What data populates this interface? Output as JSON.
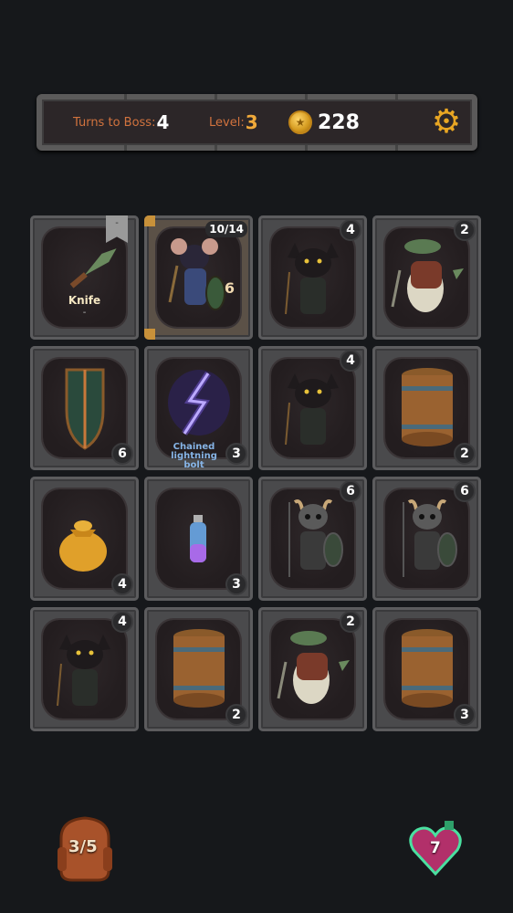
{
  "hud": {
    "turns_label": "Turns to Boss:",
    "turns_value": "4",
    "level_label": "Level:",
    "level_value": "3",
    "gold_value": "228",
    "settings_icon": "gear-icon"
  },
  "cards": [
    {
      "id": "knife",
      "kind": "weapon",
      "name": "Knife",
      "sub": "-",
      "ribbon": "-"
    },
    {
      "id": "hero",
      "kind": "hero",
      "hp": "10/14",
      "armor": "6"
    },
    {
      "id": "cat-rogue-1",
      "kind": "enemy",
      "value": "4"
    },
    {
      "id": "croc-1",
      "kind": "enemy",
      "value": "2"
    },
    {
      "id": "shield",
      "kind": "item",
      "value": "6"
    },
    {
      "id": "spell",
      "kind": "spell",
      "name": "Chained lightning bolt",
      "value": "3"
    },
    {
      "id": "cat-rogue-2",
      "kind": "enemy",
      "value": "4"
    },
    {
      "id": "barrel-1",
      "kind": "barrel",
      "value": "2"
    },
    {
      "id": "gold-bag",
      "kind": "gold",
      "value": "4"
    },
    {
      "id": "potion-card",
      "kind": "potion",
      "value": "3"
    },
    {
      "id": "skeleton-1",
      "kind": "enemy",
      "value": "6"
    },
    {
      "id": "skeleton-2",
      "kind": "enemy",
      "value": "6"
    },
    {
      "id": "cat-rogue-3",
      "kind": "enemy",
      "value": "4"
    },
    {
      "id": "barrel-2",
      "kind": "barrel",
      "value": "2"
    },
    {
      "id": "croc-2",
      "kind": "enemy",
      "value": "2"
    },
    {
      "id": "barrel-3",
      "kind": "barrel",
      "value": "3"
    }
  ],
  "backpack": {
    "label": "3/5"
  },
  "potion_button": {
    "label": "7"
  }
}
